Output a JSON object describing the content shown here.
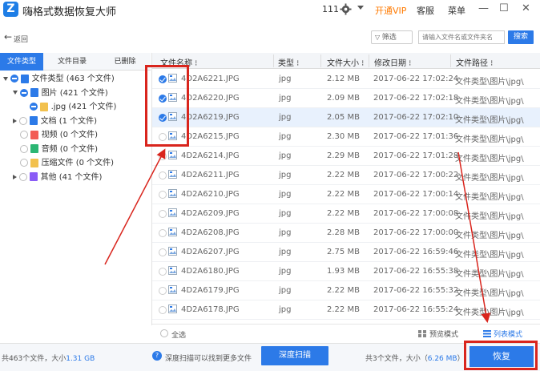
{
  "titlebar": {
    "logo_text": "Z",
    "title": "嗨格式数据恢复大师",
    "count": "111",
    "vip": "开通VIP",
    "service": "客服",
    "menu": "菜单",
    "minimize": "—",
    "maximize": "☐",
    "close": "✕"
  },
  "toolbar": {
    "back_icon": "←",
    "back_label": "返回",
    "filter_label": "筛选",
    "search_placeholder": "请输入文件名或文件夹名",
    "search_button": "搜索"
  },
  "tabs": [
    "文件类型",
    "文件目录",
    "已删除"
  ],
  "tree": [
    {
      "label": "文件类型 (463 个文件)",
      "state": "partial",
      "expanded": true,
      "icon_color": "#2c7ae8",
      "icon_name": "drive-icon"
    },
    {
      "label": "图片 (421 个文件)",
      "state": "partial",
      "expanded": true,
      "icon_color": "#2c7ae8",
      "icon_name": "image-folder-icon"
    },
    {
      "label": ".jpg (421 个文件)",
      "state": "partial",
      "icon_color": "#f2c14e",
      "icon_name": "folder-icon"
    },
    {
      "label": "文档 (1 个文件)",
      "state": "empty",
      "collapsed": true,
      "icon_color": "#2c7ae8",
      "icon_name": "document-icon"
    },
    {
      "label": "视频 (0 个文件)",
      "state": "empty",
      "icon_color": "#f25c54",
      "icon_name": "video-icon"
    },
    {
      "label": "音频 (0 个文件)",
      "state": "empty",
      "icon_color": "#2bb673",
      "icon_name": "audio-icon"
    },
    {
      "label": "压缩文件 (0 个文件)",
      "state": "empty",
      "icon_color": "#f2c14e",
      "icon_name": "archive-icon"
    },
    {
      "label": "其他 (41 个文件)",
      "state": "empty",
      "collapsed": true,
      "icon_color": "#8a5cf6",
      "icon_name": "other-icon"
    }
  ],
  "table": {
    "columns": [
      "文件名称",
      "类型",
      "文件大小",
      "修改日期",
      "文件路径"
    ],
    "rows": [
      {
        "name": "4D2A6221.JPG",
        "type": "jpg",
        "size": "2.12 MB",
        "date": "2017-06-22 17:02:24",
        "path": "文件类型\\图片\\jpg\\",
        "checked": true
      },
      {
        "name": "4D2A6220.JPG",
        "type": "jpg",
        "size": "2.09 MB",
        "date": "2017-06-22 17:02:18",
        "path": "文件类型\\图片\\jpg\\",
        "checked": true
      },
      {
        "name": "4D2A6219.JPG",
        "type": "jpg",
        "size": "2.05 MB",
        "date": "2017-06-22 17:02:10",
        "path": "文件类型\\图片\\jpg\\",
        "checked": true
      },
      {
        "name": "4D2A6215.JPG",
        "type": "jpg",
        "size": "2.30 MB",
        "date": "2017-06-22 17:01:36",
        "path": "文件类型\\图片\\jpg\\",
        "checked": false
      },
      {
        "name": "4D2A6214.JPG",
        "type": "jpg",
        "size": "2.29 MB",
        "date": "2017-06-22 17:01:28",
        "path": "文件类型\\图片\\jpg\\",
        "checked": false
      },
      {
        "name": "4D2A6211.JPG",
        "type": "jpg",
        "size": "2.22 MB",
        "date": "2017-06-22 17:00:22",
        "path": "文件类型\\图片\\jpg\\",
        "checked": false
      },
      {
        "name": "4D2A6210.JPG",
        "type": "jpg",
        "size": "2.22 MB",
        "date": "2017-06-22 17:00:14",
        "path": "文件类型\\图片\\jpg\\",
        "checked": false
      },
      {
        "name": "4D2A6209.JPG",
        "type": "jpg",
        "size": "2.22 MB",
        "date": "2017-06-22 17:00:08",
        "path": "文件类型\\图片\\jpg\\",
        "checked": false
      },
      {
        "name": "4D2A6208.JPG",
        "type": "jpg",
        "size": "2.28 MB",
        "date": "2017-06-22 17:00:00",
        "path": "文件类型\\图片\\jpg\\",
        "checked": false
      },
      {
        "name": "4D2A6207.JPG",
        "type": "jpg",
        "size": "2.75 MB",
        "date": "2017-06-22 16:59:46",
        "path": "文件类型\\图片\\jpg\\",
        "checked": false
      },
      {
        "name": "4D2A6180.JPG",
        "type": "jpg",
        "size": "1.93 MB",
        "date": "2017-06-22 16:55:38",
        "path": "文件类型\\图片\\jpg\\",
        "checked": false
      },
      {
        "name": "4D2A6179.JPG",
        "type": "jpg",
        "size": "2.22 MB",
        "date": "2017-06-22 16:55:32",
        "path": "文件类型\\图片\\jpg\\",
        "checked": false
      },
      {
        "name": "4D2A6178.JPG",
        "type": "jpg",
        "size": "2.22 MB",
        "date": "2017-06-22 16:55:24",
        "path": "文件类型\\图片\\jpg\\",
        "checked": false
      }
    ],
    "selected_row": 2
  },
  "table_footer": {
    "select_all": "全选",
    "preview_mode": "预览模式",
    "list_mode": "列表模式"
  },
  "status": {
    "summary_prefix": "共",
    "summary_count": "463",
    "summary_mid": "个文件，大小",
    "summary_size": "1.31 GB",
    "help_icon": "?",
    "hint": "深度扫描可以找到更多文件",
    "deep_scan": "深度扫描",
    "selected_prefix": "共3个文件，大小（",
    "selected_size": "6.26 MB",
    "selected_suffix": "）",
    "restore": "恢复"
  },
  "colors": {
    "accent": "#2c7ae8",
    "vip": "#ff7a00",
    "annotation": "#d9251d"
  }
}
